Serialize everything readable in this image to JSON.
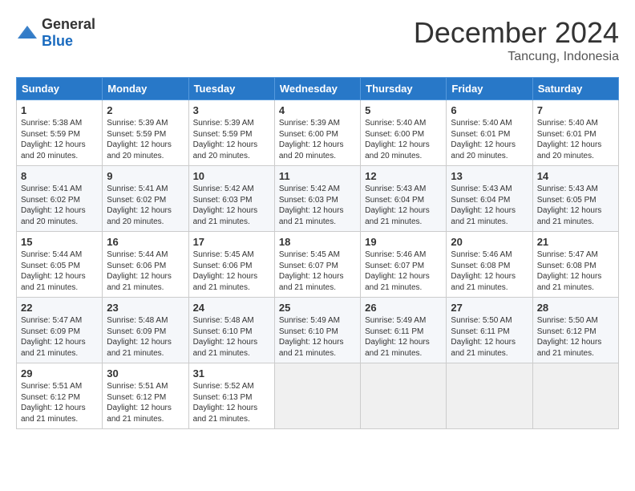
{
  "logo": {
    "general": "General",
    "blue": "Blue"
  },
  "title": "December 2024",
  "location": "Tancung, Indonesia",
  "days_of_week": [
    "Sunday",
    "Monday",
    "Tuesday",
    "Wednesday",
    "Thursday",
    "Friday",
    "Saturday"
  ],
  "weeks": [
    [
      {
        "day": "1",
        "info": "Sunrise: 5:38 AM\nSunset: 5:59 PM\nDaylight: 12 hours\nand 20 minutes."
      },
      {
        "day": "2",
        "info": "Sunrise: 5:39 AM\nSunset: 5:59 PM\nDaylight: 12 hours\nand 20 minutes."
      },
      {
        "day": "3",
        "info": "Sunrise: 5:39 AM\nSunset: 5:59 PM\nDaylight: 12 hours\nand 20 minutes."
      },
      {
        "day": "4",
        "info": "Sunrise: 5:39 AM\nSunset: 6:00 PM\nDaylight: 12 hours\nand 20 minutes."
      },
      {
        "day": "5",
        "info": "Sunrise: 5:40 AM\nSunset: 6:00 PM\nDaylight: 12 hours\nand 20 minutes."
      },
      {
        "day": "6",
        "info": "Sunrise: 5:40 AM\nSunset: 6:01 PM\nDaylight: 12 hours\nand 20 minutes."
      },
      {
        "day": "7",
        "info": "Sunrise: 5:40 AM\nSunset: 6:01 PM\nDaylight: 12 hours\nand 20 minutes."
      }
    ],
    [
      {
        "day": "8",
        "info": "Sunrise: 5:41 AM\nSunset: 6:02 PM\nDaylight: 12 hours\nand 20 minutes."
      },
      {
        "day": "9",
        "info": "Sunrise: 5:41 AM\nSunset: 6:02 PM\nDaylight: 12 hours\nand 20 minutes."
      },
      {
        "day": "10",
        "info": "Sunrise: 5:42 AM\nSunset: 6:03 PM\nDaylight: 12 hours\nand 21 minutes."
      },
      {
        "day": "11",
        "info": "Sunrise: 5:42 AM\nSunset: 6:03 PM\nDaylight: 12 hours\nand 21 minutes."
      },
      {
        "day": "12",
        "info": "Sunrise: 5:43 AM\nSunset: 6:04 PM\nDaylight: 12 hours\nand 21 minutes."
      },
      {
        "day": "13",
        "info": "Sunrise: 5:43 AM\nSunset: 6:04 PM\nDaylight: 12 hours\nand 21 minutes."
      },
      {
        "day": "14",
        "info": "Sunrise: 5:43 AM\nSunset: 6:05 PM\nDaylight: 12 hours\nand 21 minutes."
      }
    ],
    [
      {
        "day": "15",
        "info": "Sunrise: 5:44 AM\nSunset: 6:05 PM\nDaylight: 12 hours\nand 21 minutes."
      },
      {
        "day": "16",
        "info": "Sunrise: 5:44 AM\nSunset: 6:06 PM\nDaylight: 12 hours\nand 21 minutes."
      },
      {
        "day": "17",
        "info": "Sunrise: 5:45 AM\nSunset: 6:06 PM\nDaylight: 12 hours\nand 21 minutes."
      },
      {
        "day": "18",
        "info": "Sunrise: 5:45 AM\nSunset: 6:07 PM\nDaylight: 12 hours\nand 21 minutes."
      },
      {
        "day": "19",
        "info": "Sunrise: 5:46 AM\nSunset: 6:07 PM\nDaylight: 12 hours\nand 21 minutes."
      },
      {
        "day": "20",
        "info": "Sunrise: 5:46 AM\nSunset: 6:08 PM\nDaylight: 12 hours\nand 21 minutes."
      },
      {
        "day": "21",
        "info": "Sunrise: 5:47 AM\nSunset: 6:08 PM\nDaylight: 12 hours\nand 21 minutes."
      }
    ],
    [
      {
        "day": "22",
        "info": "Sunrise: 5:47 AM\nSunset: 6:09 PM\nDaylight: 12 hours\nand 21 minutes."
      },
      {
        "day": "23",
        "info": "Sunrise: 5:48 AM\nSunset: 6:09 PM\nDaylight: 12 hours\nand 21 minutes."
      },
      {
        "day": "24",
        "info": "Sunrise: 5:48 AM\nSunset: 6:10 PM\nDaylight: 12 hours\nand 21 minutes."
      },
      {
        "day": "25",
        "info": "Sunrise: 5:49 AM\nSunset: 6:10 PM\nDaylight: 12 hours\nand 21 minutes."
      },
      {
        "day": "26",
        "info": "Sunrise: 5:49 AM\nSunset: 6:11 PM\nDaylight: 12 hours\nand 21 minutes."
      },
      {
        "day": "27",
        "info": "Sunrise: 5:50 AM\nSunset: 6:11 PM\nDaylight: 12 hours\nand 21 minutes."
      },
      {
        "day": "28",
        "info": "Sunrise: 5:50 AM\nSunset: 6:12 PM\nDaylight: 12 hours\nand 21 minutes."
      }
    ],
    [
      {
        "day": "29",
        "info": "Sunrise: 5:51 AM\nSunset: 6:12 PM\nDaylight: 12 hours\nand 21 minutes."
      },
      {
        "day": "30",
        "info": "Sunrise: 5:51 AM\nSunset: 6:12 PM\nDaylight: 12 hours\nand 21 minutes."
      },
      {
        "day": "31",
        "info": "Sunrise: 5:52 AM\nSunset: 6:13 PM\nDaylight: 12 hours\nand 21 minutes."
      },
      {
        "day": "",
        "info": ""
      },
      {
        "day": "",
        "info": ""
      },
      {
        "day": "",
        "info": ""
      },
      {
        "day": "",
        "info": ""
      }
    ]
  ]
}
